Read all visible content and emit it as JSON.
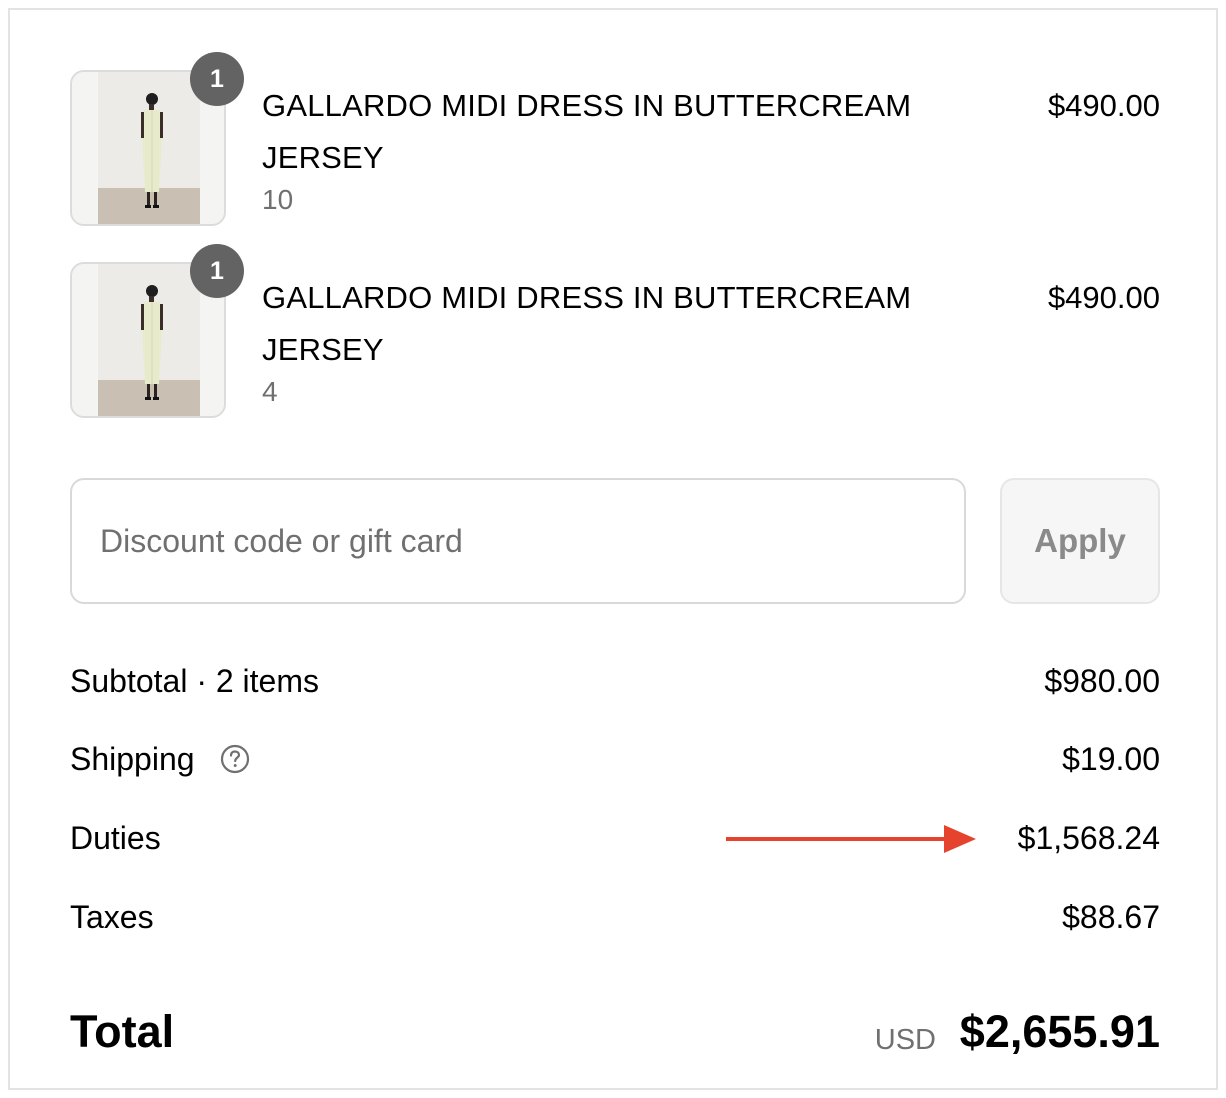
{
  "items": [
    {
      "quantity": "1",
      "title": "GALLARDO MIDI DRESS IN BUTTERCREAM JERSEY",
      "variant": "10",
      "price": "$490.00",
      "image_icon": "dress-product-image"
    },
    {
      "quantity": "1",
      "title": "GALLARDO MIDI DRESS IN BUTTERCREAM JERSEY",
      "variant": "4",
      "price": "$490.00",
      "image_icon": "dress-product-image"
    }
  ],
  "discount": {
    "placeholder": "Discount code or gift card",
    "value": "",
    "apply_label": "Apply"
  },
  "summary": {
    "subtotal_label": "Subtotal · 2 items",
    "subtotal_value": "$980.00",
    "shipping_label": "Shipping",
    "shipping_value": "$19.00",
    "shipping_icon": "help-circle-icon",
    "duties_label": "Duties",
    "duties_value": "$1,568.24",
    "taxes_label": "Taxes",
    "taxes_value": "$88.67"
  },
  "total": {
    "label": "Total",
    "currency": "USD",
    "value": "$2,655.91"
  },
  "colors": {
    "annotation_arrow": "#e5432d",
    "badge": "#636363",
    "muted_text": "#707070"
  }
}
